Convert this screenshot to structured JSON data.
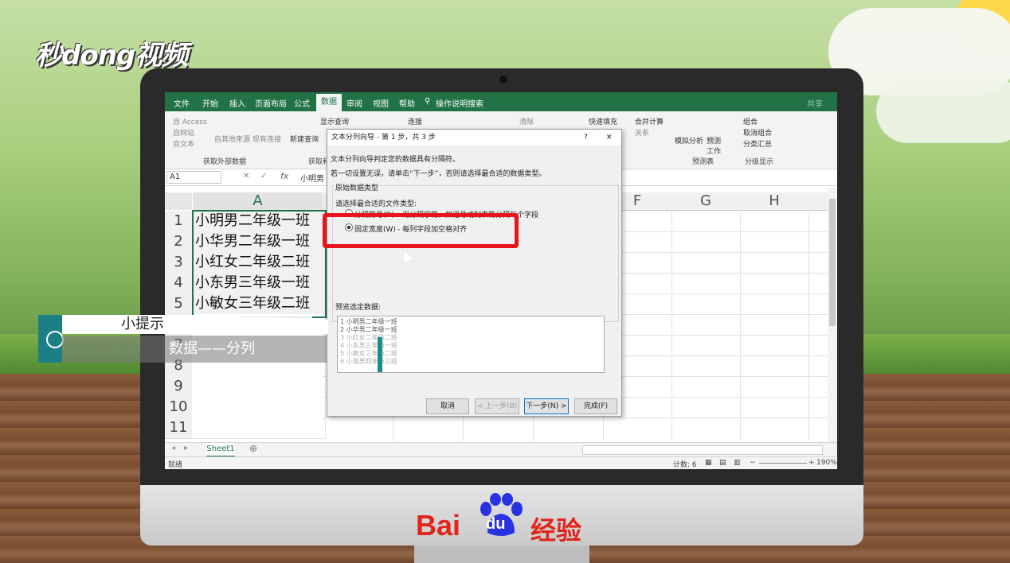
{
  "watermark": {
    "logo_text": "秒dong视频",
    "baidu_text": "经验"
  },
  "excel": {
    "tabs": [
      "文件",
      "开始",
      "插入",
      "页面布局",
      "公式",
      "数据",
      "审阅",
      "视图",
      "帮助",
      "操作说明搜索"
    ],
    "active_tab": "数据",
    "share": "共享",
    "ribbon": {
      "access": "自 Access",
      "website": "自网站",
      "text": "自文本",
      "other_sources": "自其他来源",
      "existing_conn": "现有连接",
      "group_external": "获取外部数据",
      "new_query": "新建查询",
      "show_query": "显示查询",
      "group_get": "获取和",
      "connections": "连接",
      "clear": "清除",
      "flash_fill": "快速填充",
      "consolidate": "合并计算",
      "relations": "关系",
      "what_if": "模拟分析",
      "forecast_sheet": "预测工作表",
      "group_forecast": "预测",
      "group": "组合",
      "ungroup": "取消组合",
      "subtotal": "分类汇总",
      "group_outline": "分级显示"
    },
    "name_box": "A1",
    "formula": "小明男",
    "columns": [
      "A",
      "F",
      "G",
      "H"
    ],
    "rows": [
      "1",
      "2",
      "3",
      "4",
      "5",
      "6",
      "7",
      "8",
      "9",
      "10",
      "11"
    ],
    "cells": [
      "小明男二年级一班",
      "小华男二年级一班",
      "小红女二年级二班",
      "小东男三年级一班",
      "小敏女三年级二班"
    ],
    "sheet_tab": "Sheet1",
    "status": {
      "ready": "就绪",
      "count": "计数: 6",
      "zoom": "190%"
    }
  },
  "dialog": {
    "title": "文本分列向导 - 第 1 步，共 3 步",
    "help": "?",
    "close": "✕",
    "line1": "文本分列向导判定您的数据具有分隔符。",
    "line2": "若一切设置无误，请单击“下一步”，否则请选择最合适的数据类型。",
    "group_label": "原始数据类型",
    "prompt": "请选择最合适的文件类型:",
    "option1_label": "分隔符号(D)",
    "option1_desc": "- 用分隔字符，如逗号或制表符分隔每个字段",
    "option2_label": "固定宽度(W)",
    "option2_desc": "- 每列字段加空格对齐",
    "preview_label": "预览选定数据:",
    "preview_lines": [
      "1 小明男二年级一班",
      "2 小华男二年级一班",
      "3 小红女二年级二班",
      "4 小东男三年级一班",
      "5 小敏女三年级二班",
      "6 小强男四年级三班"
    ],
    "btn_cancel": "取消",
    "btn_back": "< 上一步(B)",
    "btn_next": "下一步(N) >",
    "btn_finish": "完成(F)"
  },
  "tip": {
    "title": "小提示",
    "body": "数据——分列"
  },
  "colors": {
    "excel_green": "#217346",
    "highlight_red": "#e8141c",
    "tip_teal": "#1d7f86"
  }
}
